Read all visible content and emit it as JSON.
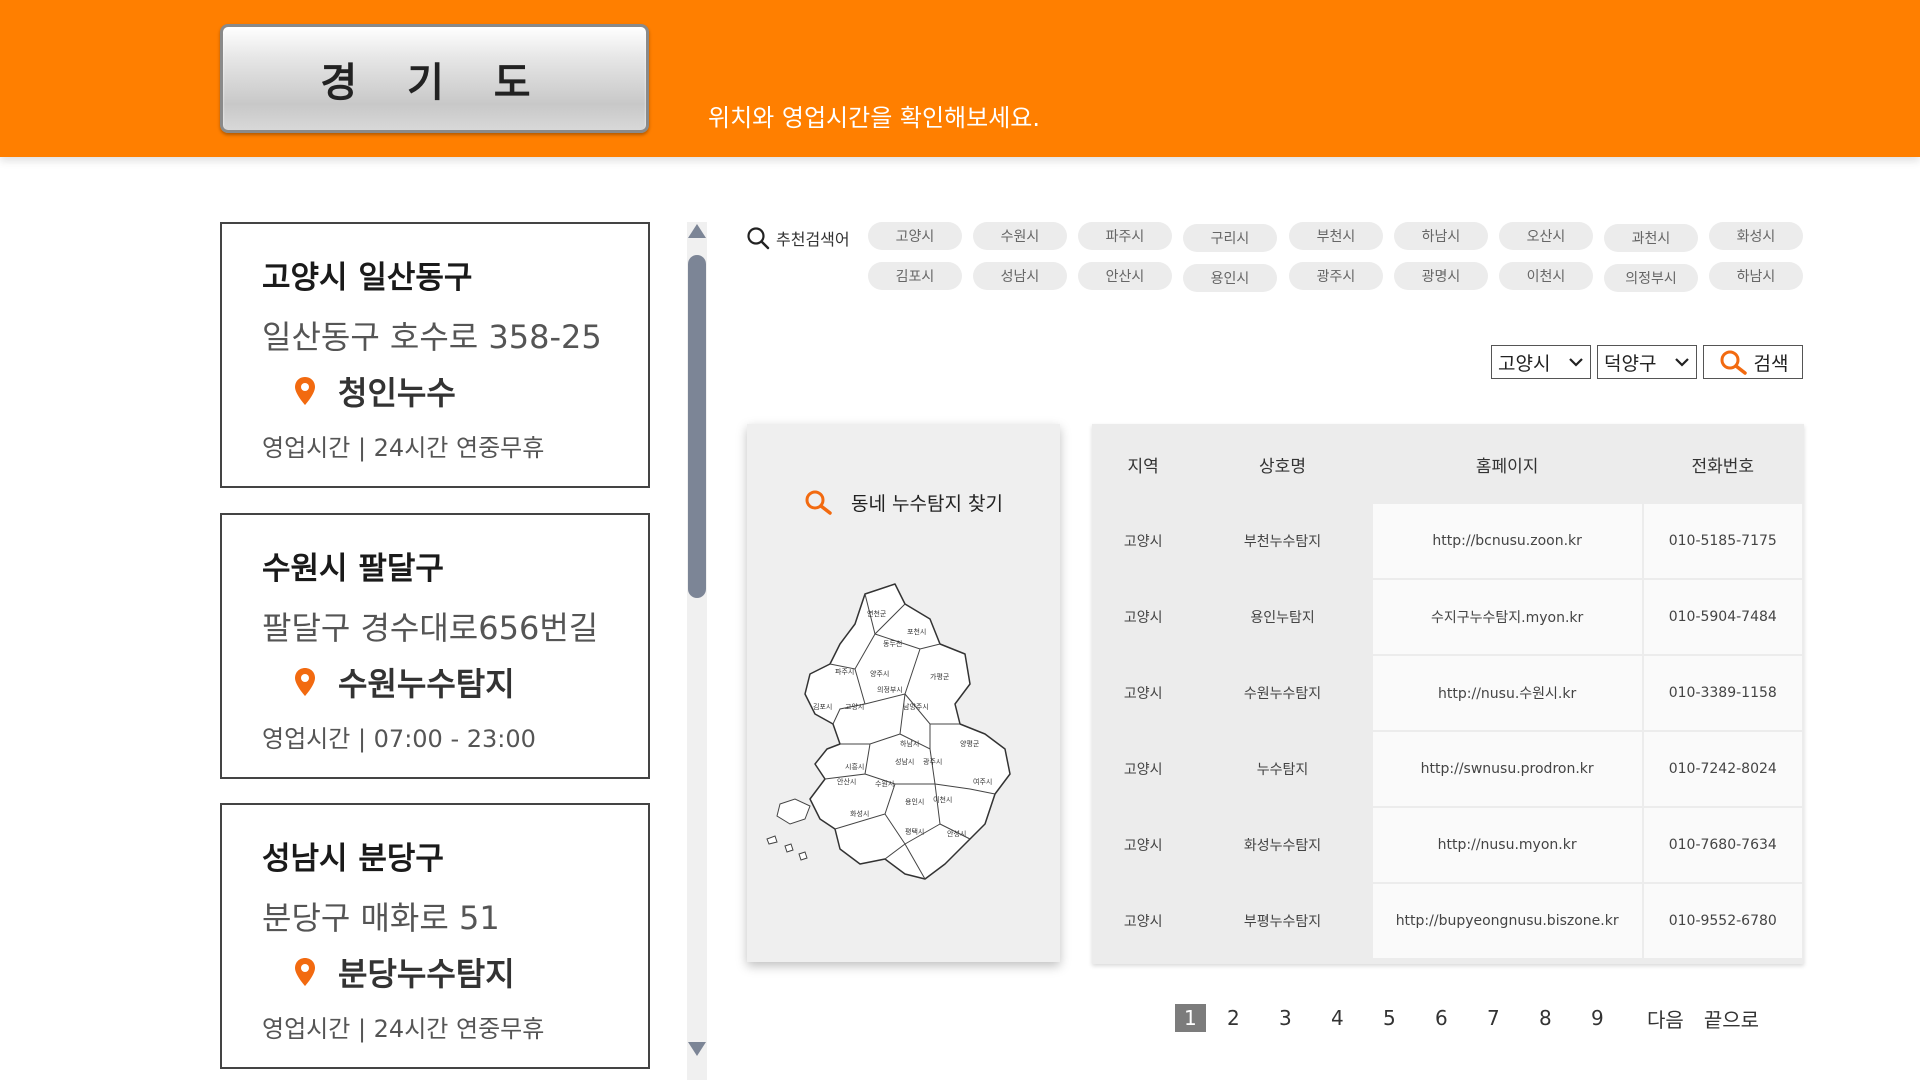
{
  "header": {
    "region_button": "경 기 도",
    "subtitle": "위치와 영업시간을 확인해보세요."
  },
  "cards": [
    {
      "title": "고양시 일산동구",
      "address": "일산동구 호수로 358-25",
      "store": "청인누수",
      "hours": "영업시간  |  24시간 연중무휴"
    },
    {
      "title": "수원시 팔달구",
      "address": "팔달구 경수대로656번길",
      "store": "수원누수탐지",
      "hours": "영업시간  |  07:00 - 23:00"
    },
    {
      "title": "성남시 분당구",
      "address": "분당구 매화로 51",
      "store": "분당누수탐지",
      "hours": "영업시간  |  24시간 연중무휴"
    }
  ],
  "recommend": {
    "label": "추천검색어",
    "row1": [
      "고양시",
      "수원시",
      "파주시",
      "구리시",
      "부천시",
      "하남시",
      "오산시",
      "과천시",
      "화성시"
    ],
    "row2": [
      "김포시",
      "성남시",
      "안산시",
      "용인시",
      "광주시",
      "광명시",
      "이천시",
      "의정부시",
      "하남시"
    ]
  },
  "filters": {
    "city": "고양시",
    "district": "덕양구",
    "search_label": "검색"
  },
  "map": {
    "title": "동네 누수탐지 찾기"
  },
  "table": {
    "headers": [
      "지역",
      "상호명",
      "홈페이지",
      "전화번호"
    ],
    "rows": [
      {
        "region": "고양시",
        "name": "부천누수탐지",
        "homepage": "http://bcnusu.zoon.kr",
        "phone": "010-5185-7175"
      },
      {
        "region": "고양시",
        "name": "용인누탐지",
        "homepage": "수지구누수탐지.myon.kr",
        "phone": "010-5904-7484"
      },
      {
        "region": "고양시",
        "name": "수원누수탐지",
        "homepage": "http://nusu.수원시.kr",
        "phone": "010-3389-1158"
      },
      {
        "region": "고양시",
        "name": "누수탐지",
        "homepage": "http://swnusu.prodron.kr",
        "phone": "010-7242-8024"
      },
      {
        "region": "고양시",
        "name": "화성누수탐지",
        "homepage": "http://nusu.myon.kr",
        "phone": "010-7680-7634"
      },
      {
        "region": "고양시",
        "name": "부평누수탐지",
        "homepage": "http://bupyeongnusu.biszone.kr",
        "phone": "010-9552-6780"
      }
    ]
  },
  "pagination": {
    "pages": [
      "1",
      "2",
      "3",
      "4",
      "5",
      "6",
      "7",
      "8",
      "9"
    ],
    "current": "1",
    "next": "다음",
    "last": "끝으로"
  },
  "colors": {
    "brand_orange": "#ff7f00",
    "pin_orange": "#f26a10",
    "scroll_thumb": "#7c8596"
  }
}
